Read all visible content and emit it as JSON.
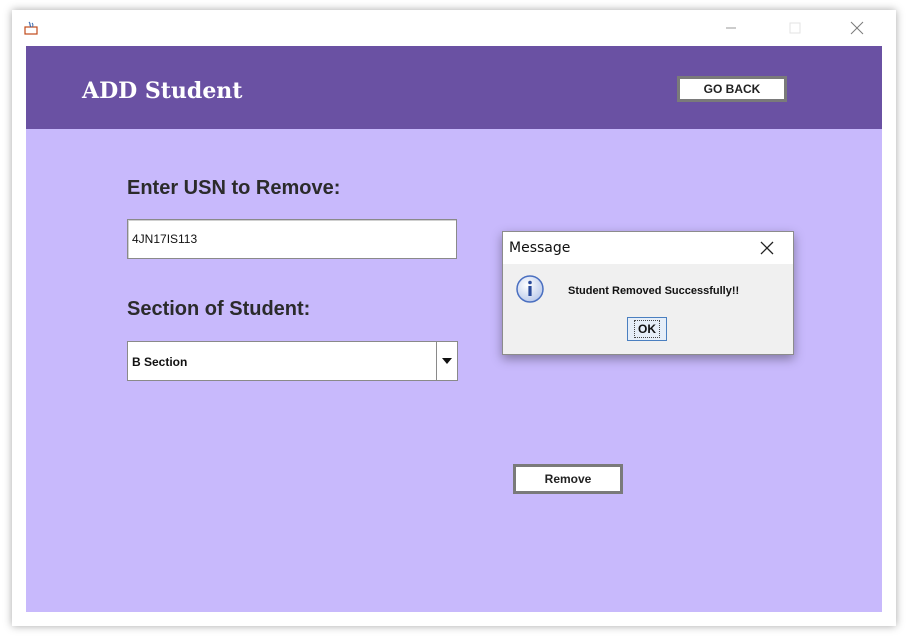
{
  "header": {
    "title": "ADD Student",
    "go_back_label": "GO BACK"
  },
  "form": {
    "usn_label": "Enter USN to Remove:",
    "usn_value": "4JN17IS113",
    "section_label": "Section of Student:",
    "section_selected": "B Section",
    "remove_label": "Remove"
  },
  "dialog": {
    "title": "Message",
    "message": "Student Removed Successfully!!",
    "ok_label": "OK"
  },
  "colors": {
    "header_bg": "#6a51a3",
    "content_bg": "#c8b9fc",
    "info_icon": "#4a6fc0"
  },
  "icons": {
    "app": "java-icon",
    "minimize": "minimize-icon",
    "maximize": "maximize-icon",
    "close": "close-icon",
    "info": "info-icon",
    "dropdown": "chevron-down-icon"
  }
}
